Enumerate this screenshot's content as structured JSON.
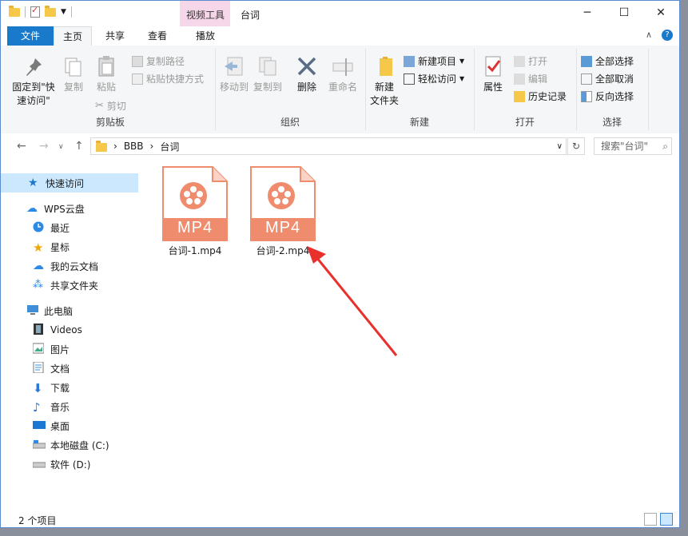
{
  "window": {
    "title": "台词",
    "context_tab_group": "视频工具"
  },
  "ribbon_tabs": [
    {
      "label": "文件"
    },
    {
      "label": "主页"
    },
    {
      "label": "共享"
    },
    {
      "label": "查看"
    },
    {
      "label": "播放"
    }
  ],
  "ribbon": {
    "clipboard": {
      "label": "剪贴板",
      "pin": "固定到\"快\n速访问\"",
      "copy": "复制",
      "paste": "粘贴",
      "copy_path": "复制路径",
      "paste_shortcut": "粘贴快捷方式",
      "cut": "剪切"
    },
    "organize": {
      "label": "组织",
      "move_to": "移动到",
      "copy_to": "复制到",
      "delete": "删除",
      "rename": "重命名"
    },
    "new": {
      "label": "新建",
      "new_folder": "新建\n文件夹",
      "new_item": "新建项目",
      "easy_access": "轻松访问"
    },
    "open": {
      "label": "打开",
      "properties": "属性",
      "open": "打开",
      "edit": "编辑",
      "history": "历史记录"
    },
    "select": {
      "label": "选择",
      "select_all": "全部选择",
      "select_none": "全部取消",
      "invert": "反向选择"
    }
  },
  "address": {
    "crumbs": [
      "BBB",
      "台词"
    ],
    "search_placeholder": "搜索\"台词\""
  },
  "nav": {
    "quick_access": "快速访问",
    "wps_cloud": "WPS云盘",
    "recent": "最近",
    "starred": "星标",
    "my_cloud_docs": "我的云文档",
    "shared_folder": "共享文件夹",
    "this_pc": "此电脑",
    "videos": "Videos",
    "pictures": "图片",
    "documents": "文档",
    "downloads": "下载",
    "music": "音乐",
    "desktop": "桌面",
    "local_disk": "本地磁盘 (C:)",
    "software": "软件 (D:)"
  },
  "files": [
    {
      "name": "台词-1.mp4",
      "badge": "MP4"
    },
    {
      "name": "台词-2.mp4",
      "badge": "MP4"
    }
  ],
  "status": {
    "count": "2 个项目"
  },
  "colors": {
    "accent": "#1979ca",
    "mp4": "#f08c6e",
    "arrow": "#e8302c",
    "context_tab": "#f6d6e9"
  }
}
